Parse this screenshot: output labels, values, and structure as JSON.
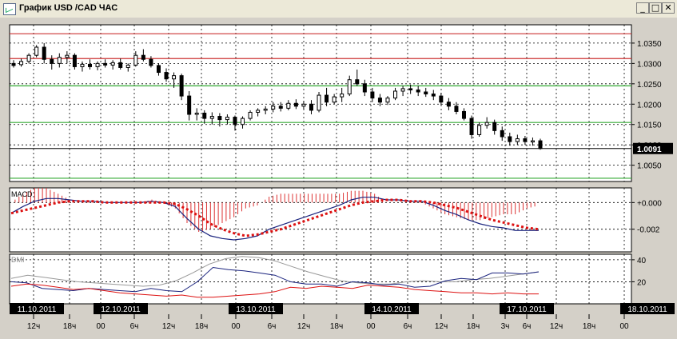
{
  "window": {
    "title": "График USD /CAD  ЧАС",
    "minimize_glyph": "_",
    "maximize_glyph": "□",
    "close_glyph": "✕"
  },
  "colors": {
    "price_candle": "#000000",
    "resistance_line": "#cc3333",
    "support_line": "#33aa33",
    "macd_line": "#1a237e",
    "macd_signal": "#dd1111",
    "macd_hist": "#dd3333",
    "dmi_adx": "#999999",
    "dmi_plus": "#1a237e",
    "dmi_minus": "#dd1111"
  },
  "chart_data": [
    {
      "type": "candlestick",
      "title": "График USD /CAD  ЧАС",
      "ylim": [
        1.001,
        1.0395
      ],
      "y_ticks": [
        "1.0350",
        "1.0300",
        "1.0250",
        "1.0200",
        "1.0150",
        "1.0100",
        "1.0050"
      ],
      "last_price": "1.0091",
      "horizontal_lines": [
        {
          "value": 1.0373,
          "color": "red"
        },
        {
          "value": 1.0312,
          "color": "red"
        },
        {
          "value": 1.0245,
          "color": "green"
        },
        {
          "value": 1.0155,
          "color": "green"
        },
        {
          "value": 1.0018,
          "color": "green"
        }
      ],
      "candles": [
        [
          1.03,
          1.0308,
          1.029,
          1.0295
        ],
        [
          1.0297,
          1.0312,
          1.0292,
          1.0305
        ],
        [
          1.0305,
          1.0325,
          1.03,
          1.032
        ],
        [
          1.032,
          1.0345,
          1.0315,
          1.034
        ],
        [
          1.034,
          1.035,
          1.03,
          1.031
        ],
        [
          1.031,
          1.032,
          1.0285,
          1.03
        ],
        [
          1.03,
          1.0325,
          1.029,
          1.0315
        ],
        [
          1.0315,
          1.033,
          1.03,
          1.032
        ],
        [
          1.032,
          1.0325,
          1.0285,
          1.0292
        ],
        [
          1.0292,
          1.0305,
          1.028,
          1.0298
        ],
        [
          1.0298,
          1.031,
          1.0285,
          1.0292
        ],
        [
          1.0292,
          1.0305,
          1.0283,
          1.03
        ],
        [
          1.03,
          1.031,
          1.029,
          1.0296
        ],
        [
          1.0296,
          1.0308,
          1.0285,
          1.0302
        ],
        [
          1.0302,
          1.0312,
          1.0285,
          1.029
        ],
        [
          1.029,
          1.03,
          1.028,
          1.0296
        ],
        [
          1.0296,
          1.033,
          1.0292,
          1.032
        ],
        [
          1.032,
          1.0335,
          1.0305,
          1.031
        ],
        [
          1.031,
          1.0318,
          1.029,
          1.0295
        ],
        [
          1.0295,
          1.03,
          1.027,
          1.0278
        ],
        [
          1.0278,
          1.0288,
          1.0255,
          1.0262
        ],
        [
          1.0262,
          1.0278,
          1.024,
          1.027
        ],
        [
          1.027,
          1.0275,
          1.021,
          1.022
        ],
        [
          1.022,
          1.0232,
          1.016,
          1.0175
        ],
        [
          1.0175,
          1.019,
          1.016,
          1.0178
        ],
        [
          1.0178,
          1.0185,
          1.0152,
          1.0165
        ],
        [
          1.0165,
          1.018,
          1.015,
          1.017
        ],
        [
          1.017,
          1.0178,
          1.0145,
          1.0162
        ],
        [
          1.0162,
          1.0175,
          1.015,
          1.0168
        ],
        [
          1.0168,
          1.0172,
          1.0135,
          1.015
        ],
        [
          1.015,
          1.017,
          1.014,
          1.0165
        ],
        [
          1.0165,
          1.0185,
          1.016,
          1.018
        ],
        [
          1.018,
          1.019,
          1.017,
          1.0185
        ],
        [
          1.0185,
          1.0195,
          1.0175,
          1.0188
        ],
        [
          1.0188,
          1.0205,
          1.018,
          1.0195
        ],
        [
          1.0195,
          1.0205,
          1.0182,
          1.019
        ],
        [
          1.019,
          1.021,
          1.0185,
          1.0202
        ],
        [
          1.0202,
          1.0212,
          1.0188,
          1.0195
        ],
        [
          1.0195,
          1.0208,
          1.0188,
          1.02
        ],
        [
          1.02,
          1.021,
          1.0175,
          1.0185
        ],
        [
          1.0185,
          1.023,
          1.018,
          1.0222
        ],
        [
          1.0222,
          1.024,
          1.0195,
          1.0205
        ],
        [
          1.0205,
          1.0225,
          1.02,
          1.0218
        ],
        [
          1.0218,
          1.024,
          1.0205,
          1.0225
        ],
        [
          1.0225,
          1.027,
          1.022,
          1.026
        ],
        [
          1.026,
          1.0285,
          1.0245,
          1.025
        ],
        [
          1.025,
          1.026,
          1.022,
          1.023
        ],
        [
          1.023,
          1.024,
          1.0205,
          1.0215
        ],
        [
          1.0215,
          1.0225,
          1.0195,
          1.0205
        ],
        [
          1.0205,
          1.022,
          1.0198,
          1.0215
        ],
        [
          1.0215,
          1.024,
          1.021,
          1.0232
        ],
        [
          1.0232,
          1.0245,
          1.022,
          1.0238
        ],
        [
          1.0238,
          1.0248,
          1.0225,
          1.0235
        ],
        [
          1.0235,
          1.0245,
          1.022,
          1.023
        ],
        [
          1.023,
          1.024,
          1.0218,
          1.0225
        ],
        [
          1.0225,
          1.0235,
          1.021,
          1.022
        ],
        [
          1.022,
          1.0228,
          1.0198,
          1.0205
        ],
        [
          1.0205,
          1.0215,
          1.0185,
          1.0195
        ],
        [
          1.0195,
          1.0205,
          1.0175,
          1.0182
        ],
        [
          1.0182,
          1.019,
          1.016,
          1.0165
        ],
        [
          1.0165,
          1.0172,
          1.0115,
          1.0125
        ],
        [
          1.0125,
          1.0155,
          1.012,
          1.0148
        ],
        [
          1.0148,
          1.0168,
          1.014,
          1.0155
        ],
        [
          1.0155,
          1.0162,
          1.0125,
          1.0135
        ],
        [
          1.0135,
          1.0145,
          1.011,
          1.012
        ],
        [
          1.012,
          1.013,
          1.0098,
          1.0108
        ],
        [
          1.0108,
          1.0125,
          1.01,
          1.0115
        ],
        [
          1.0115,
          1.0122,
          1.01,
          1.0108
        ],
        [
          1.0108,
          1.0118,
          1.0098,
          1.011
        ],
        [
          1.011,
          1.0115,
          1.0088,
          1.0091
        ]
      ]
    },
    {
      "type": "line",
      "title": "MACD",
      "ylim": [
        -0.0037,
        0.0011
      ],
      "y_ticks": [
        "+0.000",
        "-0.002"
      ],
      "series": [
        {
          "values": [
            -0.0008,
            -0.0003,
            0.0001,
            0.0003,
            0.0003,
            0.0002,
            0.0001,
            0.0001,
            0.0,
            0.0,
            0.0,
            0.0,
            0.0001,
            0.0,
            -0.0003,
            -0.0012,
            -0.002,
            -0.0025,
            -0.0027,
            -0.0028,
            -0.0027,
            -0.0025,
            -0.002,
            -0.0017,
            -0.0014,
            -0.0011,
            -0.0008,
            -0.0005,
            -0.0002,
            0.0002,
            0.0004,
            0.0004,
            0.0002,
            0.0002,
            0.0001,
            0.0001,
            -0.0002,
            -0.0006,
            -0.0009,
            -0.0013,
            -0.0016,
            -0.0018,
            -0.0019,
            -0.0021,
            -0.0021,
            -0.0021
          ]
        },
        {
          "values": [
            -0.0008,
            -0.0006,
            -0.0004,
            -0.0002,
            0.0,
            0.0001,
            0.0001,
            0.0001,
            0.0,
            0.0,
            0.0,
            0.0,
            0.0,
            0.0,
            -0.0001,
            -0.0005,
            -0.001,
            -0.0016,
            -0.002,
            -0.0023,
            -0.0025,
            -0.0024,
            -0.0022,
            -0.002,
            -0.0017,
            -0.0014,
            -0.0011,
            -0.0008,
            -0.0005,
            -0.0002,
            0.0,
            0.0001,
            0.0002,
            0.0002,
            0.0001,
            0.0001,
            0.0,
            -0.0002,
            -0.0004,
            -0.0007,
            -0.001,
            -0.0013,
            -0.0015,
            -0.0017,
            -0.0019,
            -0.002
          ]
        }
      ]
    },
    {
      "type": "line",
      "title": "DMI",
      "ylim": [
        0,
        45
      ],
      "y_ticks": [
        "40",
        "20"
      ],
      "series": [
        {
          "values": [
            23,
            26,
            24,
            22,
            20,
            19,
            18,
            17,
            16,
            17,
            21,
            28,
            36,
            41,
            43,
            42,
            39,
            34,
            29,
            25,
            21,
            19,
            18,
            18,
            20,
            21,
            20,
            20,
            22,
            23,
            25,
            27,
            29
          ]
        },
        {
          "values": [
            20,
            19,
            14,
            13,
            12,
            14,
            13,
            12,
            11,
            14,
            12,
            11,
            20,
            33,
            31,
            30,
            28,
            26,
            20,
            18,
            18,
            16,
            20,
            19,
            17,
            18,
            15,
            16,
            21,
            23,
            22,
            28,
            28,
            27,
            29
          ]
        },
        {
          "values": [
            16,
            18,
            17,
            15,
            13,
            14,
            12,
            10,
            9,
            8,
            7,
            8,
            6,
            6,
            7,
            8,
            9,
            11,
            15,
            14,
            16,
            15,
            14,
            17,
            16,
            15,
            13,
            12,
            11,
            10,
            10,
            9,
            10,
            9,
            9
          ]
        }
      ]
    }
  ],
  "x_axis": {
    "date_labels": [
      "11.10.2011",
      "12.10.2011",
      "13.10.2011",
      "14.10.2011",
      "17.10.2011",
      "18.10.2011"
    ],
    "hour_labels": [
      "12ч",
      "18ч",
      "00",
      "6ч",
      "12ч",
      "18ч",
      "00",
      "6ч",
      "12ч",
      "18ч",
      "00",
      "6ч",
      "12ч",
      "18ч",
      "3ч",
      "6ч",
      "12ч",
      "18ч",
      "00"
    ]
  }
}
